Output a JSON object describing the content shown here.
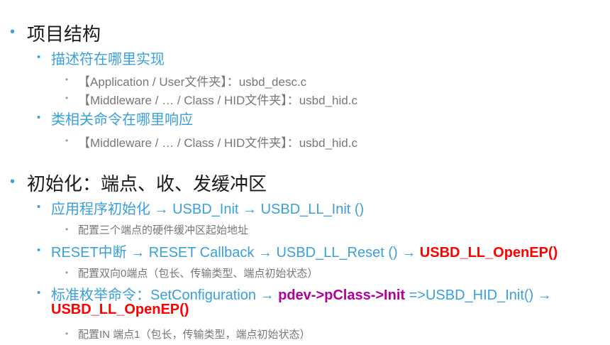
{
  "colors": {
    "heading": "#1a1a1a",
    "accent": "#3aa0d8",
    "gray": "#777777",
    "red": "#ff0000",
    "magenta": "#b0009c"
  },
  "s1": {
    "title": "项目结构",
    "desc": {
      "label": "描述符在哪里实现",
      "items": [
        "【Application / User文件夹】：usbd_desc.c",
        "【Middleware / … / Class / HID文件夹】：usbd_hid.c"
      ]
    },
    "cmd": {
      "label": "类相关命令在哪里响应",
      "items": [
        "【Middleware / … / Class / HID文件夹】：usbd_hid.c"
      ]
    }
  },
  "s2": {
    "title": "初始化：端点、收、发缓冲区",
    "i1": {
      "text": "应用程序初始化 → USBD_Init → USBD_LL_Init ()",
      "sub": "配置三个端点的硬件缓冲区起始地址"
    },
    "i2": {
      "text": "RESET中断 → RESET Callback → USBD_LL_Reset () → ",
      "red": "USBD_LL_OpenEP()",
      "sub": "配置双向0端点（包长、传输类型、端点初始状态）"
    },
    "i3": {
      "text1": "标准枚举命令：SetConfiguration → ",
      "mag": "pdev->pClass->Init",
      "text2": " =>USBD_HID_Init() →",
      "red": "USBD_LL_OpenEP()",
      "sub": "配置IN 端点1（包长，传输类型，端点初始状态）"
    }
  }
}
